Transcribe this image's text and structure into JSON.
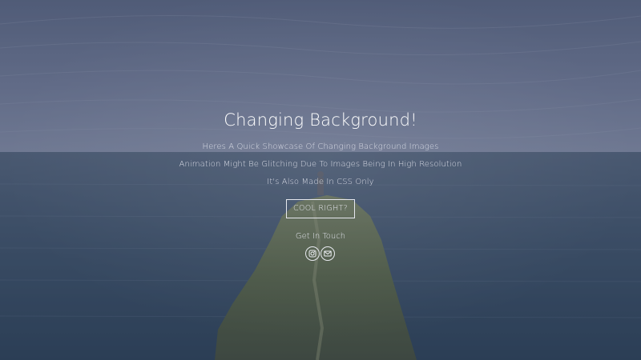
{
  "hero": {
    "title": "Changing Background!",
    "tagline_lines": [
      "Heres A Quick Showcase Of Changing Background Images",
      "Animation Might Be Glitching Due To Images Being In High Resolution",
      "It's Also Made In CSS Only"
    ],
    "cta_label": "COOL RIGHT?"
  },
  "contact": {
    "heading": "Get In Touch",
    "links": [
      {
        "icon": "instagram-icon"
      },
      {
        "icon": "mail-icon"
      }
    ]
  },
  "colors": {
    "text": "#ffffff",
    "sky": "#5e6a86",
    "sea": "#2e4256",
    "cliff": "#5a6a3c"
  }
}
